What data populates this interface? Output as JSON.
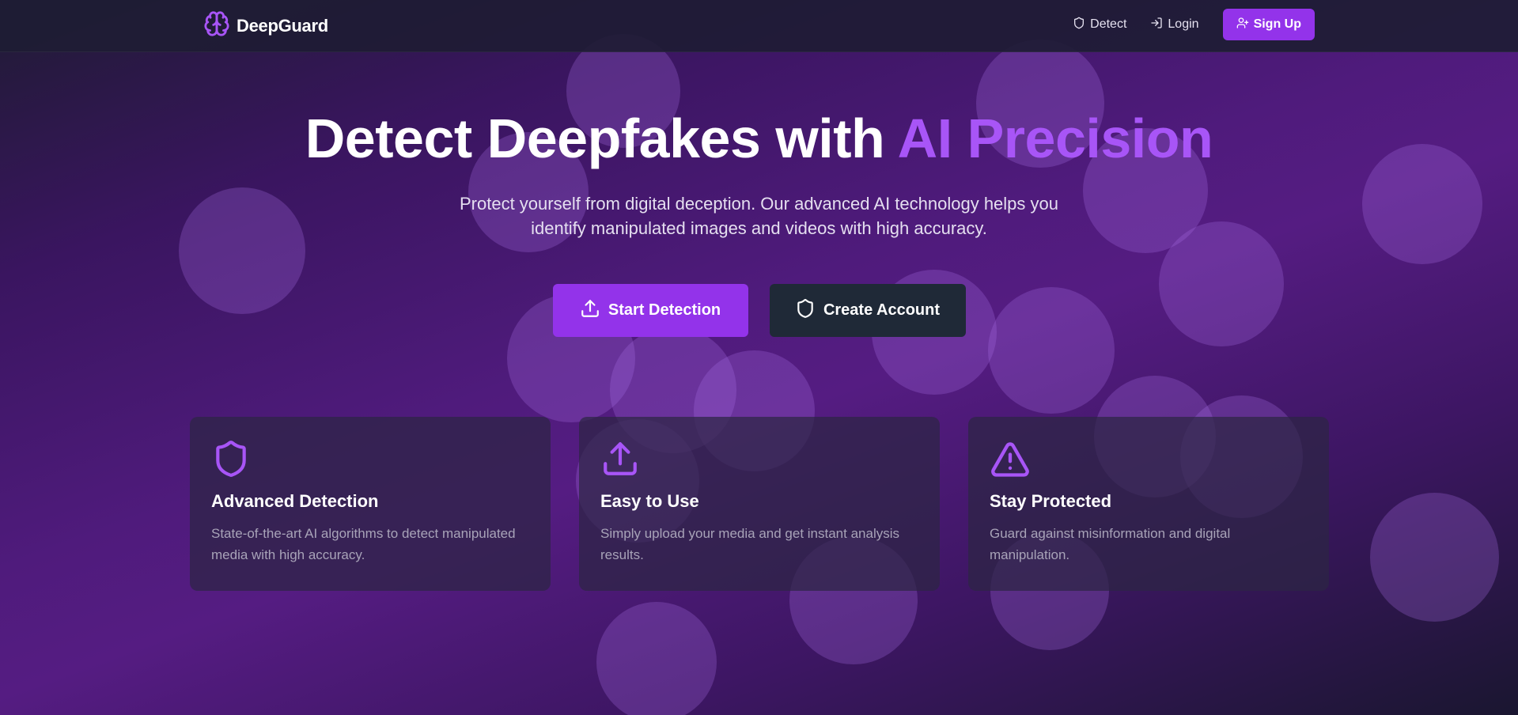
{
  "brand": {
    "name": "DeepGuard",
    "icon": "brain-icon",
    "accent_color": "#a855f7"
  },
  "nav": {
    "detect_label": "Detect",
    "login_label": "Login",
    "signup_label": "Sign Up"
  },
  "hero": {
    "title_main": "Detect Deepfakes with ",
    "title_accent": "AI Precision",
    "subtitle": "Protect yourself from digital deception. Our advanced AI technology helps you identify manipulated images and videos with high accuracy.",
    "primary_button": "Start Detection",
    "secondary_button": "Create Account"
  },
  "features": [
    {
      "icon": "shield-icon",
      "title": "Advanced Detection",
      "text": "State-of-the-art AI algorithms to detect manipulated media with high accuracy."
    },
    {
      "icon": "upload-icon",
      "title": "Easy to Use",
      "text": "Simply upload your media and get instant analysis results."
    },
    {
      "icon": "alert-triangle-icon",
      "title": "Stay Protected",
      "text": "Guard against misinformation and digital manipulation."
    }
  ],
  "colors": {
    "primary": "#9333ea",
    "dark_button": "#1f2937",
    "accent": "#a855f7"
  }
}
